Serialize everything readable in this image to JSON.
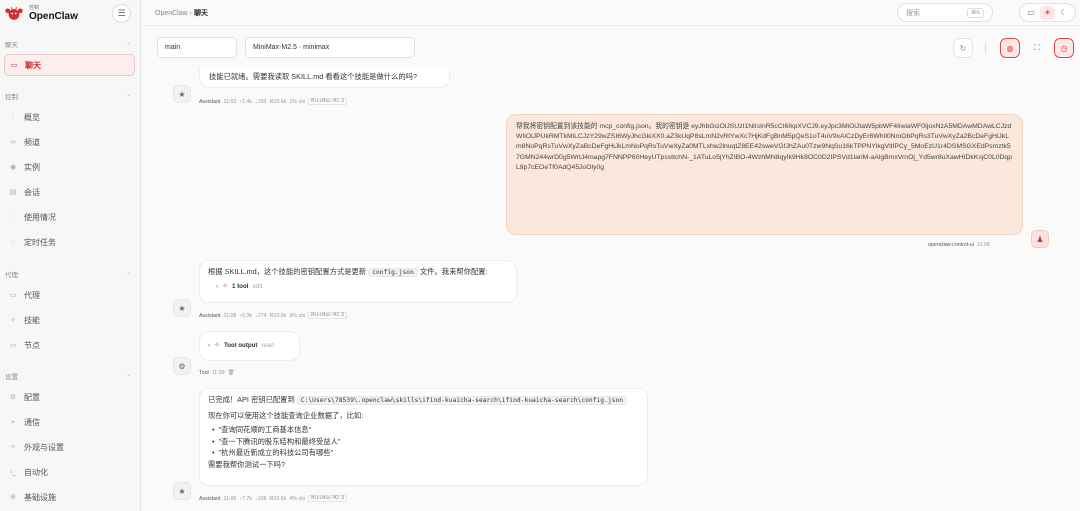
{
  "brand": {
    "subtitle": "控制",
    "title": "OpenClaw"
  },
  "sidebar": {
    "sections": [
      {
        "label": "聊天",
        "items": [
          {
            "label": "聊天",
            "icon": "chat-icon"
          }
        ]
      },
      {
        "label": "控制",
        "items": [
          {
            "label": "概览",
            "icon": "bar-chart-icon"
          },
          {
            "label": "频道",
            "icon": "link-icon"
          },
          {
            "label": "实例",
            "icon": "radio-icon"
          },
          {
            "label": "会话",
            "icon": "file-icon"
          },
          {
            "label": "使用情况",
            "icon": "bar-chart-icon"
          },
          {
            "label": "定时任务",
            "icon": "loader-icon"
          }
        ]
      },
      {
        "label": "代理",
        "items": [
          {
            "label": "代理",
            "icon": "folder-icon"
          },
          {
            "label": "技能",
            "icon": "sparkle-icon"
          },
          {
            "label": "节点",
            "icon": "monitor-icon"
          }
        ]
      },
      {
        "label": "设置",
        "items": [
          {
            "label": "配置",
            "icon": "gear-icon"
          },
          {
            "label": "通信",
            "icon": "send-icon"
          },
          {
            "label": "外观与设置",
            "icon": "sparkle-icon"
          },
          {
            "label": "自动化",
            "icon": "terminal-icon"
          },
          {
            "label": "基础设施",
            "icon": "globe-icon"
          }
        ]
      }
    ]
  },
  "header": {
    "breadcrumb_root": "OpenClaw",
    "breadcrumb_sep": "›",
    "breadcrumb_current": "聊天"
  },
  "search": {
    "placeholder": "搜索",
    "shortcut": "⌘K"
  },
  "session": {
    "agent": "main",
    "model": "MiniMax-M2.5 · minimax"
  },
  "messages": {
    "m1": {
      "text": "技能已就绪。需要我读取 SKILL.md 看看这个技能是做什么的吗?",
      "who": "Assistant",
      "time": "11:03",
      "stats": [
        "↑1.4k",
        "↓193",
        "R10.6k",
        "1% ctx"
      ],
      "model": "MiniMax-M2.5"
    },
    "m2": {
      "text": "帮我将密钥配置到该技能的 mcp_config.json。我的密钥是 eyJhbGciOiJSUzI1NiIsInR5cCI6IkpXVCJ9.eyJpc3MiOiJtaW5pbWF4IiwiaWF0IjoxNzA5MDAwMDAwLCJzdWIiOiJPUkRMTkMiLCJzY29wZSI6WyJhcGkiXX0.aZ3kUqP8sLmN2vRtYwXc7HjKdFgBnM5pQeS1oT4uV9xAiCzDyEr6WhIl0NmObPqRs3TuVwXyZa2BcDeFgHiJkLm8NoPqRsTuVwXyZaBcDeFgHiJkLmNoPqRsTuVwXyZa0MTLxhw2lnuqtZ8EE42sweVGfJhZAu0Tzw9NqSu16kTPPNYlkgVltIPCy_5MoEzU1r4DSMSGXEdPsmztk57GMN244wrD0g5WrtJ4mapg7FNNPP60HeyUTpssttchN-_1ATuLo5jYhZIBO-4WzhMN8qyIk9Hk8OC0D2IPSVd1lariM-aAlgBmxVrnOj_Yd5wr8uXawHIDkKsjC0L0DqpL9p7cEOeTf0AdQ45JoOly0g",
      "who": "openclaw-control-ui",
      "time": "11:08"
    },
    "m3": {
      "pre": "根据 SKILL.md，这个技能的密钥配置方式是更新",
      "code": "config.json",
      "post": "文件。我来帮你配置:",
      "tool_label": "1 tool",
      "tool_status": "edit",
      "who": "Assistant",
      "time": "11:08",
      "stats": [
        "↑6.3k",
        "↓774",
        "R10.6k",
        "3% ctx"
      ],
      "model": "MiniMax-M2.5"
    },
    "m4": {
      "tool_label": "Tool output",
      "tool_status": "read",
      "who": "Tool",
      "time": "11:09"
    },
    "m5": {
      "pre": "已完成！API 密钥已配置到",
      "path": "C:\\Users\\78539\\.openclaw\\skills\\ifind-kuaicha-search\\ifind-kuaicha-search\\config.json",
      "line2": "现在你可以使用这个技能查询企业数据了，比如:",
      "bullets": [
        "\"查询同花顺的工商基本信息\"",
        "\"查一下腾讯的股东结构和最终受益人\"",
        "\"杭州最近新成立的科技公司有哪些\""
      ],
      "closing": "需要我帮你测试一下吗?",
      "who": "Assistant",
      "time": "11:09",
      "stats": [
        "↑7.7k",
        "↓106",
        "R10.6k",
        "4% ctx"
      ],
      "model": "MiniMax-M2.5"
    }
  },
  "colors": {
    "accent": "#d32f2f",
    "user_bubble": "#fbe7dc"
  }
}
